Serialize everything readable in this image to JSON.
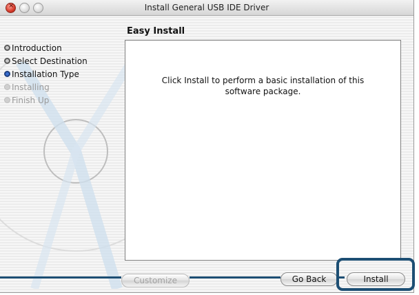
{
  "window": {
    "title": "Install General USB IDE Driver"
  },
  "sidebar": {
    "steps": [
      {
        "label": "Introduction",
        "state": "done"
      },
      {
        "label": "Select Destination",
        "state": "done"
      },
      {
        "label": "Installation Type",
        "state": "current"
      },
      {
        "label": "Installing",
        "state": "pending"
      },
      {
        "label": "Finish Up",
        "state": "pending"
      }
    ]
  },
  "main": {
    "section_title": "Easy Install",
    "body_text": "Click Install to perform a basic installation of this software package."
  },
  "buttons": {
    "customize": "Customize",
    "go_back": "Go Back",
    "install": "Install"
  },
  "colors": {
    "callout": "#1c4e73",
    "current_step": "#3a6fd0"
  }
}
